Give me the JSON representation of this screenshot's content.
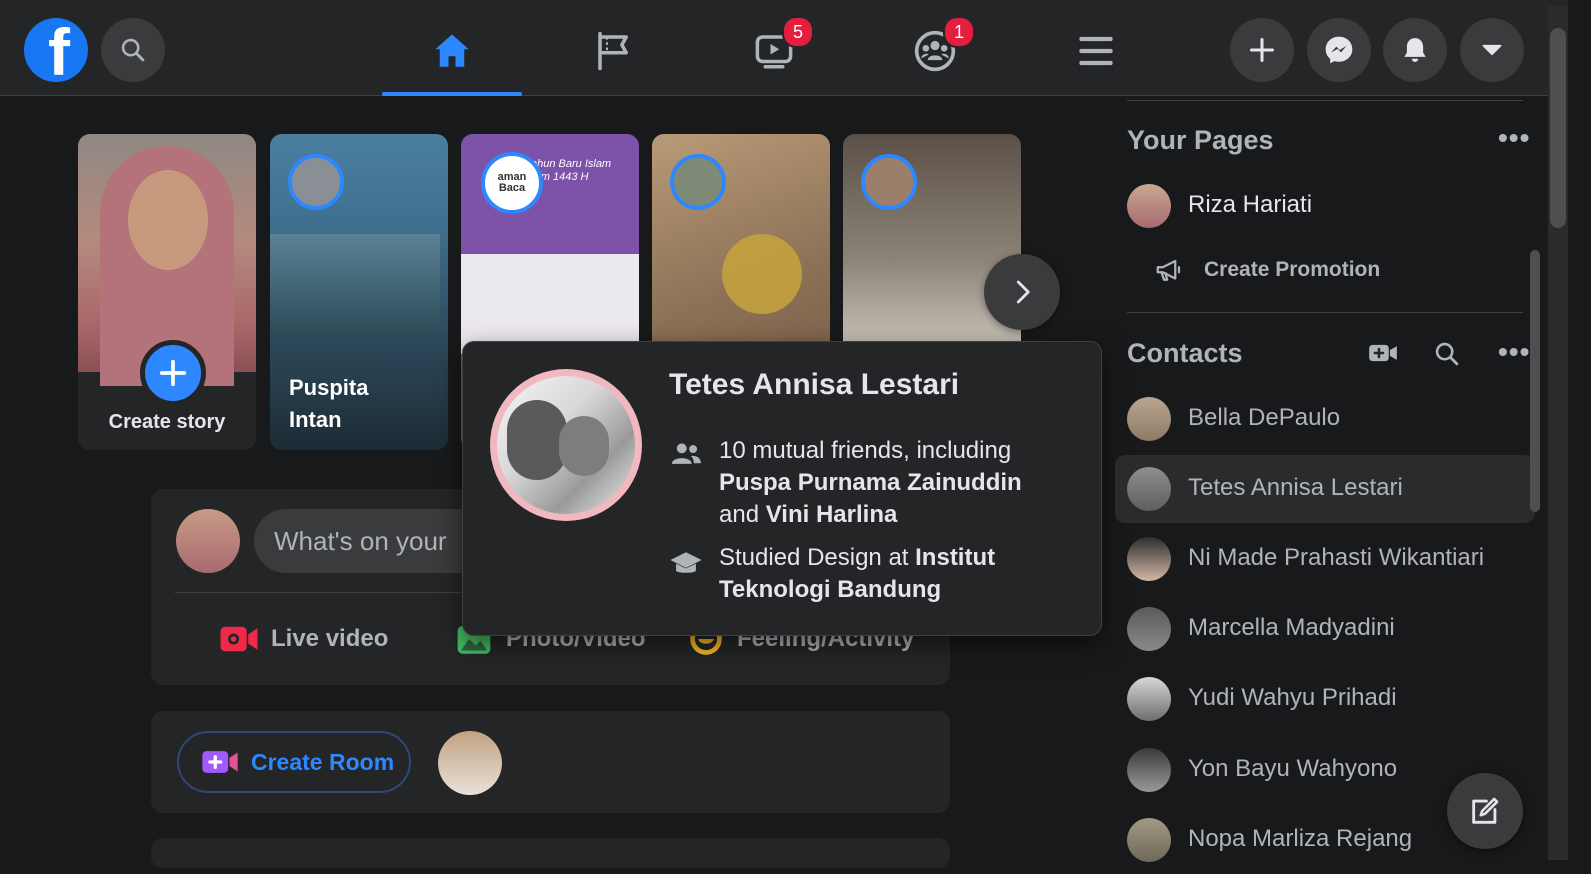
{
  "header": {
    "logo_letter": "f",
    "nav_badges": {
      "watch": "5",
      "groups": "1"
    }
  },
  "stories": {
    "create_label": "Create story",
    "items": [
      {
        "name": "Puspita\nIntan"
      },
      {
        "name": ""
      },
      {
        "name": ""
      },
      {
        "name": ""
      }
    ],
    "ramadan_text": "ahun Baru Islam\nram 1443 H",
    "aman_baca": "aman\nBaca"
  },
  "composer": {
    "placeholder": "What's on your",
    "actions": {
      "live": "Live video",
      "photo": "Photo/Video",
      "feeling": "Feeling/Activity"
    }
  },
  "rooms": {
    "create_label": "Create Room"
  },
  "hovercard": {
    "name": "Tetes Annisa Lestari",
    "mutual_prefix": "10 mutual friends, including",
    "mutual_friend_1": "Puspa Purnama Zainuddin",
    "mutual_and": "and",
    "mutual_friend_2": "Vini Harlina",
    "studied_prefix": "Studied Design at",
    "school": "Institut Teknologi Bandung"
  },
  "right": {
    "your_pages_title": "Your Pages",
    "page_name": "Riza Hariati",
    "create_promotion": "Create Promotion",
    "contacts_title": "Contacts",
    "contacts": [
      "Bella DePaulo",
      "Tetes Annisa Lestari",
      "Ni Made Prahasti Wikantiari",
      "Marcella Madyadini",
      "Yudi Wahyu Prihadi",
      "Yon Bayu Wahyono",
      "Nopa Marliza Rejang"
    ]
  },
  "colors": {
    "accent": "#2d88ff",
    "badge": "#e41e3f",
    "background": "#18191a",
    "surface": "#242526"
  }
}
